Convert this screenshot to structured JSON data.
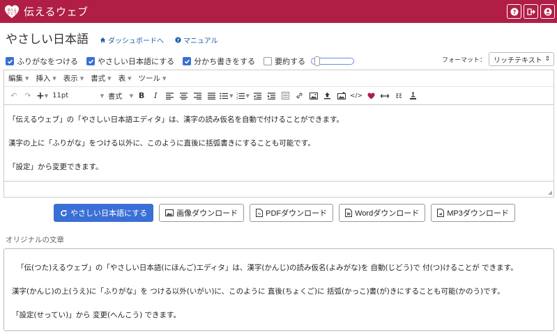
{
  "app": {
    "name": "伝えるウェブ",
    "logo_text": "伝える ウェブ",
    "accent": "#b01e46"
  },
  "header": {
    "title": "やさしい日本語",
    "links": [
      {
        "label": "ダッシュボードへ",
        "icon": "home-icon"
      },
      {
        "label": "マニュアル",
        "icon": "question-circle-icon"
      }
    ]
  },
  "topbar_icons": [
    "help-icon",
    "logout-icon",
    "user-icon"
  ],
  "options": {
    "furigana": {
      "label": "ふりがなをつける",
      "checked": true
    },
    "easy_japanese": {
      "label": "やさしい日本語にする",
      "checked": true
    },
    "wakachi": {
      "label": "分かち書きをする",
      "checked": true
    },
    "summary": {
      "label": "要約する",
      "checked": false
    }
  },
  "format": {
    "label": "フォーマット：",
    "value": "リッチテキスト"
  },
  "editor": {
    "menu": [
      "編集",
      "挿入",
      "表示",
      "書式",
      "表",
      "ツール"
    ],
    "font_size": "11pt",
    "format_dropdown": "書式",
    "paragraphs": [
      "「伝えるウェブ」の「やさしい日本語エディタ」は、漢字の読み仮名を自動で付けることができます。",
      "漢字の上に「ふりがな」をつける以外に、このように直後に括弧書きにすることも可能です。",
      "「設定」から変更できます。"
    ]
  },
  "buttons": {
    "convert": "やさしい日本語にする",
    "image_download": "画像ダウンロード",
    "pdf_download": "PDFダウンロード",
    "word_download": "Wordダウンロード",
    "mp3_download": "MP3ダウンロード"
  },
  "original": {
    "label": "オリジナルの文章",
    "paragraphs": [
      "「伝(つた)えるウェブ」の「やさしい日本語(にほんご)エディタ」は、漢字(かんじ)の読み仮名(よみがな)を 自動(じどう)で 付(つ)けることが できます。",
      "漢字(かんじ)の上(うえ)に「ふりがな」を つける以外(いがい)に、このように 直後(ちょくご)に 括弧(かっこ)書(が)きにすることも可能(かのう)です。",
      "「設定(せってい)」から 変更(へんこう) できます。"
    ]
  }
}
